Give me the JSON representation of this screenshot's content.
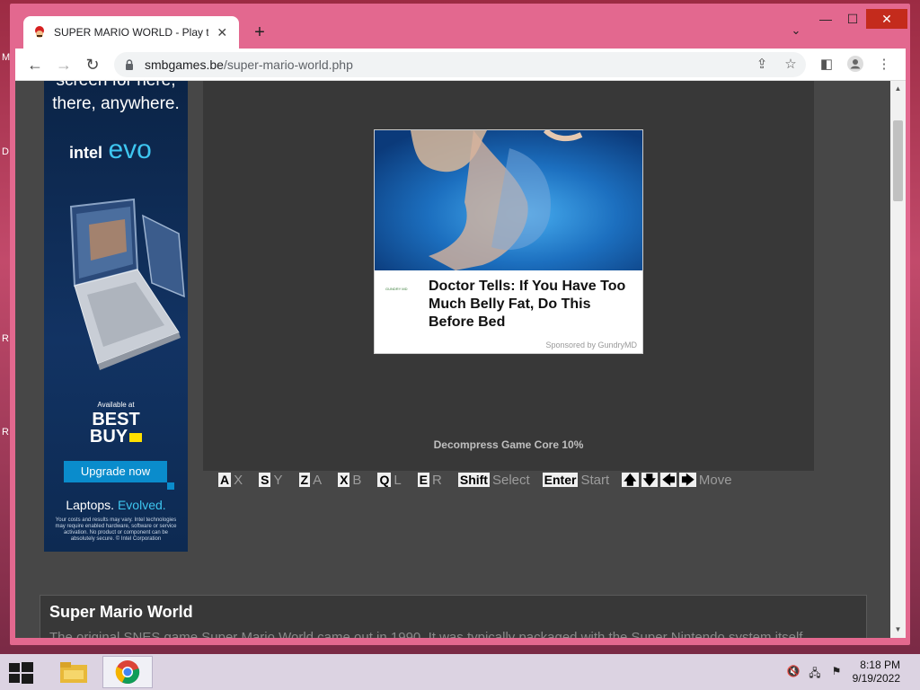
{
  "desktop": {
    "letters": [
      "M",
      "D",
      "R",
      "R"
    ]
  },
  "browser": {
    "tab_title": "SUPER MARIO WORLD - Play the",
    "url_host": "smbgames.be",
    "url_path": "/super-mario-world.php"
  },
  "side_ad": {
    "hero_line1": "screen for here,",
    "hero_line2": "there, anywhere.",
    "intel": "intel",
    "evo": "evo",
    "available": "Available at",
    "bestbuy_1": "BEST",
    "bestbuy_2": "BUY",
    "button": "Upgrade now",
    "tagline_a": "Laptops. ",
    "tagline_b": "Evolved.",
    "fine_print": "Your costs and results may vary. Intel technologies may require enabled hardware, software or service activation. No product or component can be absolutely secure. © Intel Corporation"
  },
  "game_ad": {
    "headline": "Doctor Tells: If You Have Too Much Belly Fat, Do This Before Bed",
    "sponsor": "Sponsored by GundryMD",
    "logo_text": "GUNDRY MD"
  },
  "game": {
    "loading": "Decompress Game Core 10%"
  },
  "controls": [
    {
      "key": "A",
      "action": "X"
    },
    {
      "key": "S",
      "action": "Y"
    },
    {
      "key": "Z",
      "action": "A"
    },
    {
      "key": "X",
      "action": "B"
    },
    {
      "key": "Q",
      "action": "L"
    },
    {
      "key": "E",
      "action": "R"
    },
    {
      "key": "Shift",
      "action": "Select"
    },
    {
      "key": "Enter",
      "action": "Start"
    }
  ],
  "move_label": "Move",
  "description": {
    "title": "Super Mario World",
    "text": "The original SNES game Super Mario World came out in 1990. It was typically packaged with the Super Nintendo system itself"
  },
  "taskbar": {
    "time": "8:18 PM",
    "date": "9/19/2022"
  },
  "colors": {
    "frame": "#e3688f",
    "page_bg": "#474747",
    "game_bg": "#383838",
    "upgrade_button": "#0a8ccc"
  }
}
